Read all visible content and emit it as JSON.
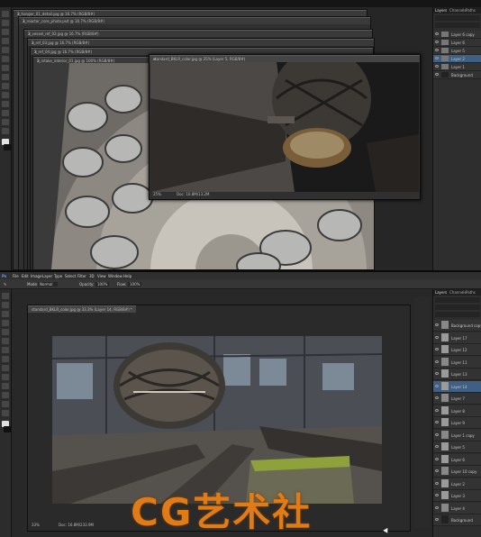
{
  "top": {
    "doc_tabs": [
      "2_hanger_01_detail.jpg @ 16.7% (RGB/8#)",
      "2_reactor_core_photo.psd @ 16.7% (RGB/8#)",
      "2_vessel_ref_02.jpg @ 16.7% (RGB/8#)",
      "2_ref_03.jpg @ 16.7% (RGB/8#)",
      "2_ref_04.jpg @ 16.7% (RGB/8#)",
      "2_intake_interior_01.jpg @ 100% (RGB/8#)"
    ],
    "float_window_title": "standard_BKLR_color.jpg @ 25% (Layer 5, RGB/8#)",
    "float_status_left": "25%",
    "float_status_doc": "Doc: 10.8M/13.2M",
    "layers_tabs": [
      "Layers",
      "Channels",
      "Paths"
    ],
    "layers": [
      {
        "name": "Layer 6 copy",
        "selected": false
      },
      {
        "name": "Layer 6",
        "selected": false
      },
      {
        "name": "Layer 5",
        "selected": false
      },
      {
        "name": "Layer 2",
        "selected": true
      },
      {
        "name": "Layer 1",
        "selected": false
      },
      {
        "name": "Background",
        "selected": false
      }
    ]
  },
  "bottom": {
    "menu": [
      "Ps",
      "File",
      "Edit",
      "Image",
      "Layer",
      "Type",
      "Select",
      "Filter",
      "3D",
      "View",
      "Window",
      "Help"
    ],
    "options": {
      "mode_label": "Mode:",
      "mode_value": "Normal",
      "opacity_label": "Opacity:",
      "opacity_value": "100%",
      "flow_label": "Flow:",
      "flow_value": "100%"
    },
    "doc_tab": "standard_BKLR_color.jpg @ 33.3% (Layer 14, RGB/8#) *",
    "status_zoom": "33%",
    "status_doc": "Doc: 16.8M/233.9M",
    "layers_tabs": [
      "Layers",
      "Channels",
      "Paths"
    ],
    "layers": [
      {
        "name": "Background copy",
        "selected": false
      },
      {
        "name": "Layer 17",
        "selected": false
      },
      {
        "name": "Layer 12",
        "selected": false
      },
      {
        "name": "Layer 11",
        "selected": false
      },
      {
        "name": "Layer 13",
        "selected": false
      },
      {
        "name": "Layer 14",
        "selected": true
      },
      {
        "name": "Layer 7",
        "selected": false
      },
      {
        "name": "Layer 8",
        "selected": false
      },
      {
        "name": "Layer 9",
        "selected": false
      },
      {
        "name": "Layer 1 copy",
        "selected": false
      },
      {
        "name": "Layer 5",
        "selected": false
      },
      {
        "name": "Layer 6",
        "selected": false
      },
      {
        "name": "Layer 10 copy",
        "selected": false
      },
      {
        "name": "Layer 2",
        "selected": false
      },
      {
        "name": "Layer 3",
        "selected": false
      },
      {
        "name": "Layer 4",
        "selected": false
      },
      {
        "name": "Background",
        "selected": false
      }
    ]
  },
  "watermark": "CG艺术社",
  "colors": {
    "accent_selected": "#3f5f84",
    "watermark": "#e07c18"
  }
}
